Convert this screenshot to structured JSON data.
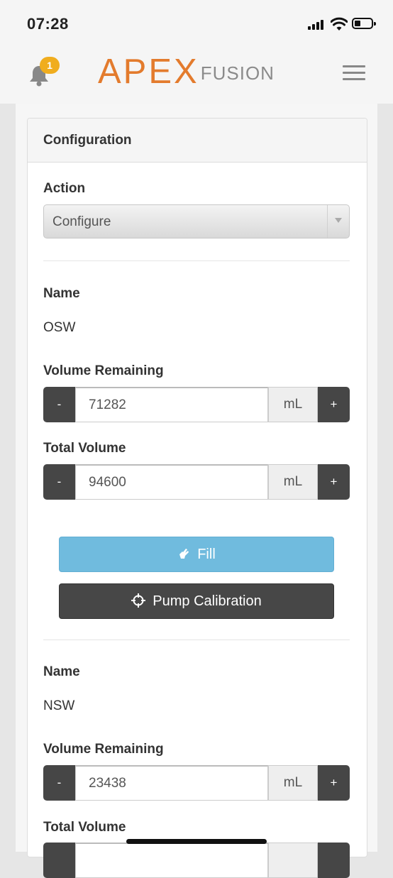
{
  "status_bar": {
    "time": "07:28"
  },
  "header": {
    "notification_count": "1",
    "logo_primary": "APEX",
    "logo_secondary": "FUSION"
  },
  "panel": {
    "title": "Configuration",
    "action_label": "Action",
    "action_value": "Configure",
    "name_label": "Name",
    "volume_remaining_label": "Volume Remaining",
    "total_volume_label": "Total Volume",
    "minus": "-",
    "plus": "+",
    "unit": "mL",
    "containers": [
      {
        "name": "OSW",
        "volume_remaining": "71282",
        "total_volume": "94600"
      },
      {
        "name": "NSW",
        "volume_remaining": "23438",
        "total_volume": ""
      }
    ],
    "fill_button": "Fill",
    "pump_calibration_button": "Pump Calibration"
  },
  "colors": {
    "brand_orange": "#e37b2d",
    "badge": "#f0ad1e",
    "fill_button": "#70bbde",
    "dark_button": "#474747"
  }
}
